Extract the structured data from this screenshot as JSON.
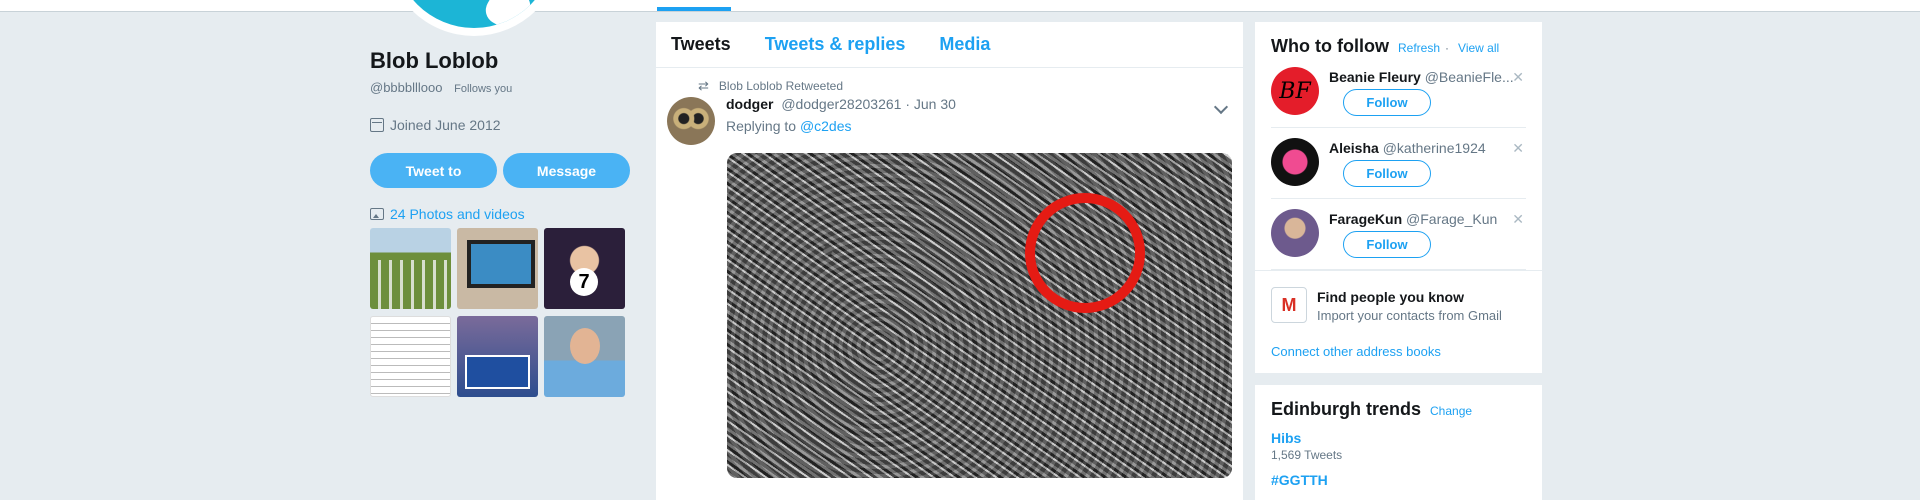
{
  "profile": {
    "name": "Blob Loblob",
    "handle": "@bbbblllooo",
    "follows_you": "Follows you",
    "joined": "Joined June 2012",
    "tweet_to": "Tweet to",
    "message": "Message",
    "photos_link": "24 Photos and videos"
  },
  "tabs": [
    "Tweets",
    "Tweets & replies",
    "Media"
  ],
  "tweet": {
    "retweeted_by": "Blob Loblob Retweeted",
    "name": "dodger",
    "handle": "@dodger28203261",
    "date": "· Jun 30",
    "replying_prefix": "Replying to",
    "replying_to": "@c2des"
  },
  "who_to_follow": {
    "title": "Who to follow",
    "refresh": "Refresh",
    "sep": "·",
    "view_all": "View all",
    "follow_label": "Follow",
    "users": [
      {
        "name": "Beanie Fleury",
        "handle": "@BeanieFle...",
        "avatar_text": "BF"
      },
      {
        "name": "Aleisha",
        "handle": "@katherine1924"
      },
      {
        "name": "FarageKun",
        "handle": "@Farage_Kun"
      }
    ],
    "find_title": "Find people you know",
    "find_sub": "Import your contacts from Gmail",
    "connect": "Connect other address books"
  },
  "trends": {
    "title": "Edinburgh trends",
    "change": "Change",
    "items": [
      {
        "name": "Hibs",
        "count": "1,569 Tweets"
      },
      {
        "name": "#GGTTH",
        "count": ""
      }
    ]
  },
  "colors": {
    "accent": "#1da1f2",
    "button": "#4ab3f4",
    "background": "#e6ecf0",
    "highlight_circle": "#e51b14"
  }
}
